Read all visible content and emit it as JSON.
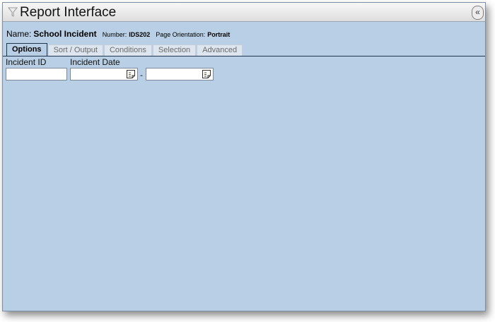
{
  "window": {
    "title": "Report Interface",
    "collapse_glyph": "«"
  },
  "report_info": {
    "name_label": "Name:",
    "name_value": "School Incident",
    "number_label": "Number:",
    "number_value": "IDS202",
    "orientation_label": "Page Orientation:",
    "orientation_value": "Portrait"
  },
  "tabs": [
    {
      "label": "Options",
      "active": true
    },
    {
      "label": "Sort / Output",
      "active": false
    },
    {
      "label": "Conditions",
      "active": false
    },
    {
      "label": "Selection",
      "active": false
    },
    {
      "label": "Advanced",
      "active": false
    }
  ],
  "options": {
    "incident_id_label": "Incident ID",
    "incident_id_value": "",
    "incident_date_label": "Incident Date",
    "date_from_value": "",
    "date_to_value": "",
    "range_separator": "-"
  },
  "icons": {
    "title": "filter-icon",
    "calendar": "calendar-icon"
  },
  "colors": {
    "panel_background": "#b9cfe5",
    "tab_border": "#22354f",
    "titlebar": "#e8e8e8"
  }
}
